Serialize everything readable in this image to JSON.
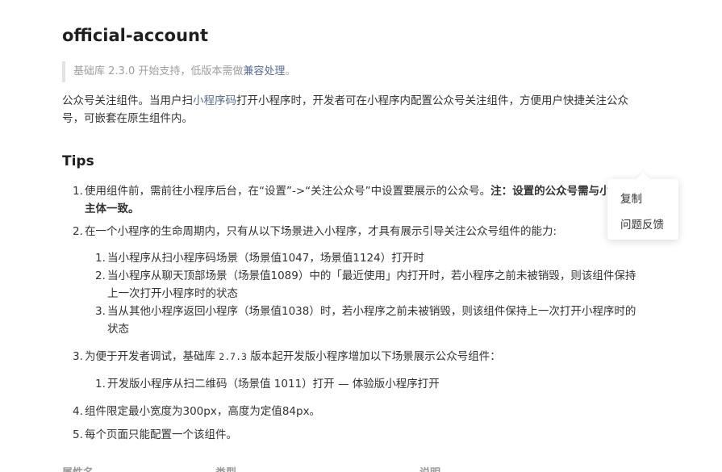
{
  "page": {
    "title": "official-account",
    "note": {
      "prefix": "基础库 2.3.0 开始支持，低版本需做",
      "link": "兼容处理",
      "suffix": "。"
    },
    "intro": {
      "part1": "公众号关注组件。当用户扫",
      "link": "小程序码",
      "part2": "打开小程序时，开发者可在小程序内配置公众号关注组件，方便用户快捷关注公众号，可嵌套在原生组件内。"
    },
    "tips_heading": "Tips",
    "tips": {
      "item1": {
        "num": "1.",
        "text": "使用组件前，需前往小程序后台，在“设置”->“关注公众号”中设置要展示的公众号。",
        "bold": "注：设置的公众号需与小程序主体一致。"
      },
      "item2": {
        "num": "2.",
        "text": "在一个小程序的生命周期内，只有从以下场景进入小程序，才具有展示引导关注公众号组件的能力:",
        "subs": [
          {
            "num": "1.",
            "text": "当小程序从扫小程序码场景（场景值1047，场景值1124）打开时"
          },
          {
            "num": "2.",
            "text": "当小程序从聊天顶部场景（场景值1089）中的「最近使用」内打开时，若小程序之前未被销毁，则该组件保持上一次打开小程序时的状态"
          },
          {
            "num": "3.",
            "text": "当从其他小程序返回小程序（场景值1038）时，若小程序之前未被销毁，则该组件保持上一次打开小程序时的状态"
          }
        ]
      },
      "item3": {
        "num": "3.",
        "prefix": "为便于开发者调试，基础库 ",
        "code": "2.7.3",
        "suffix": " 版本起开发版小程序增加以下场景展示公众号组件：",
        "subs": [
          {
            "num": "1.",
            "text": "开发版小程序从扫二维码（场景值 1011）打开 — 体验版小程序打开"
          }
        ]
      },
      "item4": {
        "num": "4.",
        "text": "组件限定最小宽度为300px，高度为定值84px。"
      },
      "item5": {
        "num": "5.",
        "text": "每个页面只能配置一个该组件。"
      }
    },
    "table_header": [
      "属性名",
      "类型",
      "说明"
    ]
  },
  "popup": {
    "copy_label": "复制",
    "feedback_label": "问题反馈"
  }
}
